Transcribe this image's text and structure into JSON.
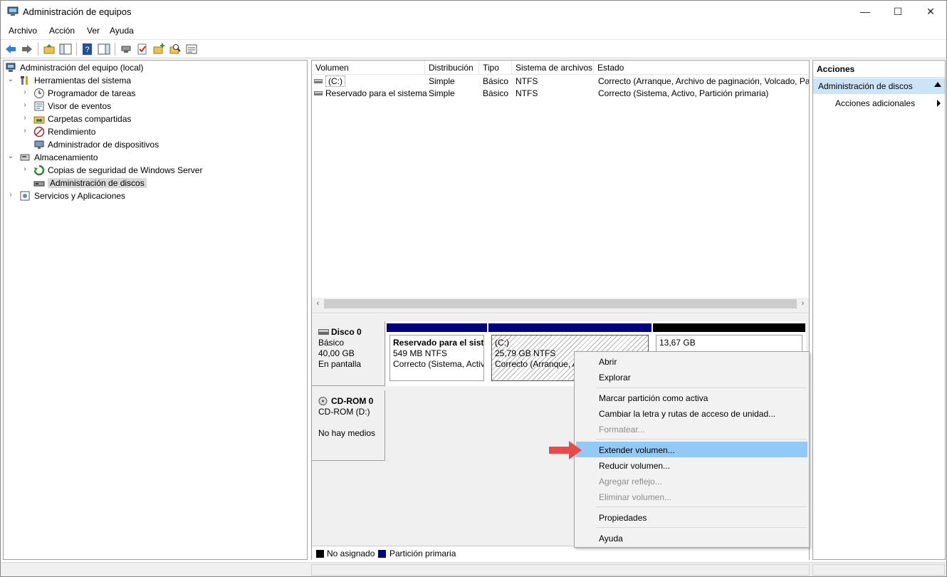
{
  "window": {
    "title": "Administración de equipos",
    "controls": {
      "minimize": "—",
      "maximize": "☐",
      "close": "✕"
    }
  },
  "menubar": {
    "items": [
      "Archivo",
      "Acción",
      "Ver",
      "Ayuda"
    ]
  },
  "toolbar": {
    "icons": [
      "back-arrow-icon",
      "forward-arrow-icon",
      "folder-up-icon",
      "show-hide-tree-icon",
      "help-icon",
      "show-actions-icon",
      "connect-icon",
      "check-icon",
      "new-folder-icon",
      "search-icon",
      "properties-icon"
    ]
  },
  "tree": {
    "root": "Administración del equipo (local)",
    "system_tools": "Herramientas del sistema",
    "task_scheduler": "Programador de tareas",
    "event_viewer": "Visor de eventos",
    "shared_folders": "Carpetas compartidas",
    "performance": "Rendimiento",
    "device_manager": "Administrador de dispositivos",
    "storage": "Almacenamiento",
    "backup": "Copias de seguridad de Windows Server",
    "disk_management": "Administración de discos",
    "services_apps": "Servicios y Aplicaciones"
  },
  "volumes": {
    "columns": [
      "Volumen",
      "Distribución",
      "Tipo",
      "Sistema de archivos",
      "Estado"
    ],
    "rows": [
      {
        "volume": "(C:)",
        "layout": "Simple",
        "type": "Básico",
        "fs": "NTFS",
        "status": "Correcto (Arranque, Archivo de paginación, Volcado, Pa"
      },
      {
        "volume": "Reservado para el sistema",
        "layout": "Simple",
        "type": "Básico",
        "fs": "NTFS",
        "status": "Correcto (Sistema, Activo, Partición primaria)"
      }
    ]
  },
  "disks": {
    "disk0": {
      "name": "Disco 0",
      "type": "Básico",
      "size": "40,00 GB",
      "state": "En pantalla"
    },
    "cdrom0": {
      "name": "CD-ROM 0",
      "drive": "CD-ROM (D:)",
      "state": "No hay medios"
    },
    "partitions": [
      {
        "title": "Reservado para el siste",
        "size": "549 MB NTFS",
        "status": "Correcto (Sistema, Activ"
      },
      {
        "title": "(C:)",
        "size": "25,79 GB NTFS",
        "status": "Correcto (Arranque, A"
      },
      {
        "title": "",
        "size": "13,67 GB",
        "status": ""
      }
    ],
    "colors": {
      "primary": "#000080",
      "unallocated": "#000000"
    }
  },
  "legend": {
    "unallocated": "No asignado",
    "primary": "Partición primaria"
  },
  "actions": {
    "header": "Acciones",
    "selected": "Administración de discos",
    "more": "Acciones adicionales"
  },
  "context_menu": {
    "open": "Abrir",
    "explore": "Explorar",
    "mark_active": "Marcar partición como activa",
    "change_letter": "Cambiar la letra y rutas de acceso de unidad...",
    "format": "Formatear...",
    "extend": "Extender volumen...",
    "shrink": "Reducir volumen...",
    "add_mirror": "Agregar reflejo...",
    "delete": "Eliminar volumen...",
    "properties": "Propiedades",
    "help": "Ayuda"
  },
  "accent": "#e84a4a"
}
